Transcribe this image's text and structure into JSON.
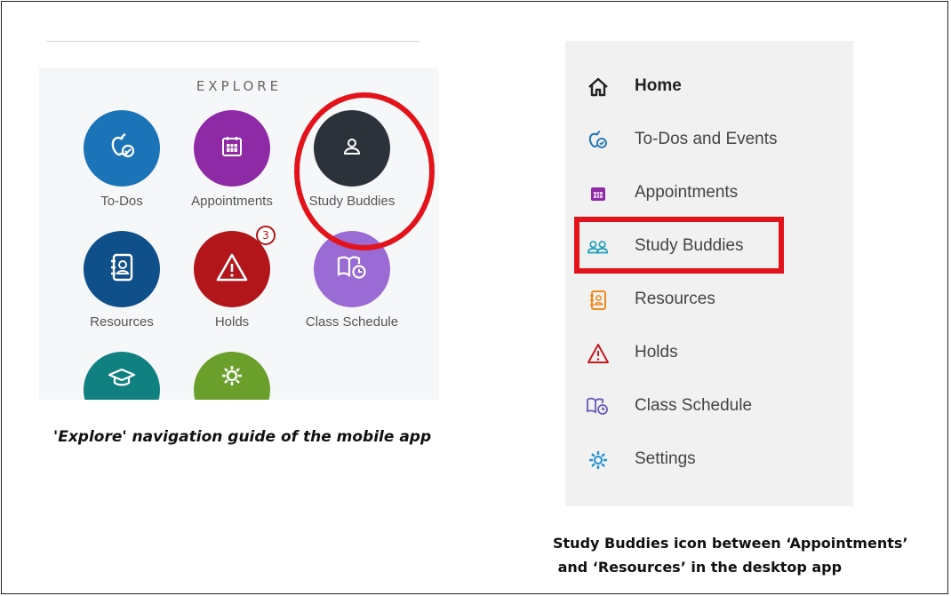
{
  "mobile": {
    "header": "EXPLORE",
    "tiles": [
      {
        "label": "To-Dos",
        "color": "#1b73b8",
        "icon": "apple-check-icon"
      },
      {
        "label": "Appointments",
        "color": "#8e2aa6",
        "icon": "calendar-icon"
      },
      {
        "label": "Study Buddies",
        "color": "#2b323a",
        "icon": "person-icon"
      },
      {
        "label": "Resources",
        "color": "#0f4f8a",
        "icon": "contact-book-icon"
      },
      {
        "label": "Holds",
        "color": "#b2161a",
        "icon": "warning-icon",
        "badge": "3"
      },
      {
        "label": "Class Schedule",
        "color": "#9a6bd4",
        "icon": "book-clock-icon"
      },
      {
        "label": "",
        "color": "#118080",
        "icon": "graduation-cap-icon"
      },
      {
        "label": "",
        "color": "#6a9f2b",
        "icon": "gear-icon"
      }
    ],
    "caption": "'Explore' navigation guide of the mobile app"
  },
  "desktop": {
    "nav": [
      {
        "label": "Home",
        "icon": "home-icon"
      },
      {
        "label": "To-Dos and Events",
        "icon": "apple-check-icon"
      },
      {
        "label": "Appointments",
        "icon": "calendar-icon"
      },
      {
        "label": "Study Buddies",
        "icon": "people-icon"
      },
      {
        "label": "Resources",
        "icon": "contact-book-icon"
      },
      {
        "label": "Holds",
        "icon": "warning-icon"
      },
      {
        "label": "Class Schedule",
        "icon": "book-clock-icon"
      },
      {
        "label": "Settings",
        "icon": "gear-icon"
      }
    ],
    "caption_line1": "Study Buddies icon between ‘Appointments’",
    "caption_line2": " and ‘Resources’ in the desktop app"
  },
  "colors": {
    "highlight": "#e3131b"
  }
}
